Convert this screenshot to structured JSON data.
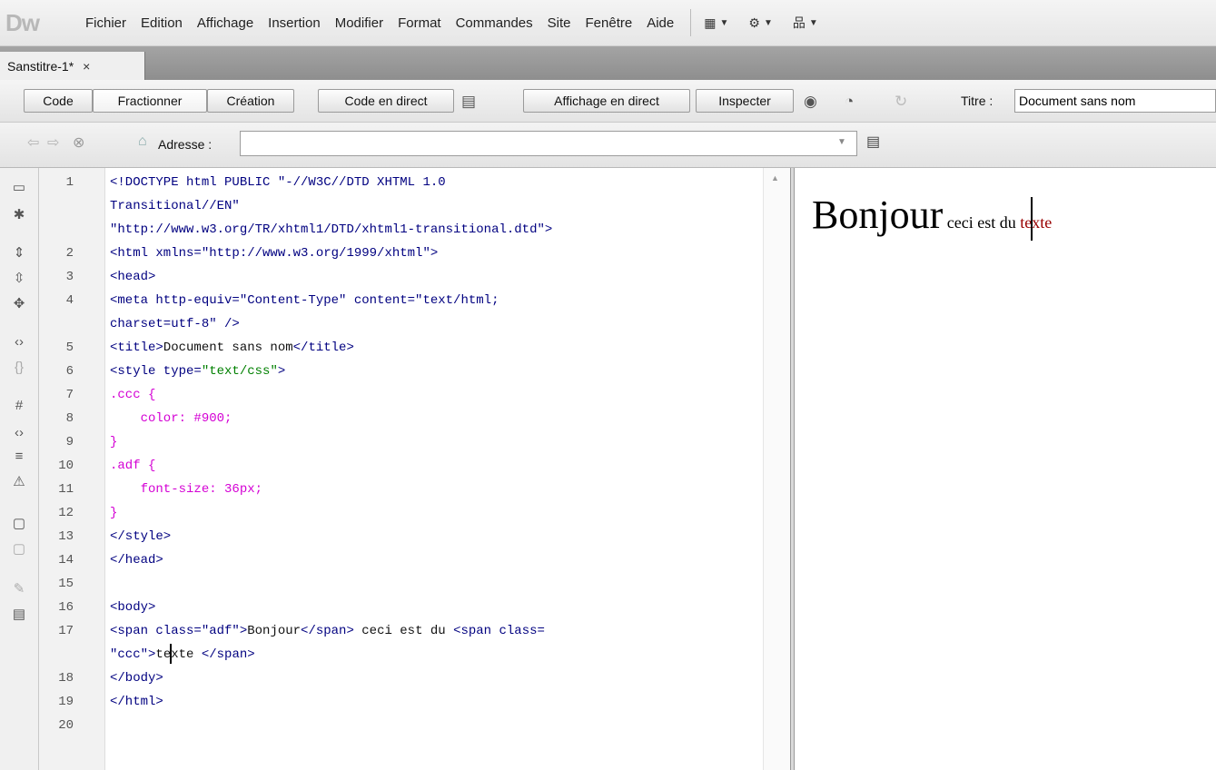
{
  "app": {
    "logo": "Dw"
  },
  "menu": [
    "Fichier",
    "Edition",
    "Affichage",
    "Insertion",
    "Modifier",
    "Format",
    "Commandes",
    "Site",
    "Fenêtre",
    "Aide"
  ],
  "menu_icons": [
    {
      "name": "layout-icon",
      "glyph": "▦"
    },
    {
      "name": "gear-icon",
      "glyph": "⚙"
    },
    {
      "name": "site-icon",
      "glyph": "品"
    }
  ],
  "document_tab": {
    "label": "Sanstitre-1*",
    "close": "×"
  },
  "view_buttons": {
    "code": "Code",
    "split": "Fractionner",
    "design": "Création",
    "live_code": "Code en direct",
    "live_view": "Affichage en direct",
    "inspect": "Inspecter"
  },
  "title_field": {
    "label": "Titre :",
    "value": "Document sans nom"
  },
  "address_bar": {
    "label": "Adresse :",
    "value": ""
  },
  "code_lines": [
    {
      "n": "1",
      "parts": [
        [
          "tag",
          "<!DOCTYPE html PUBLIC \"-//W3C//DTD XHTML 1.0"
        ]
      ]
    },
    {
      "n": "",
      "parts": [
        [
          "tag",
          "Transitional//EN\""
        ]
      ]
    },
    {
      "n": "",
      "parts": [
        [
          "tag",
          "\"http://www.w3.org/TR/xhtml1/DTD/xhtml1-transitional.dtd\">"
        ]
      ]
    },
    {
      "n": "2",
      "parts": [
        [
          "tag",
          "<html xmlns=\"http://www.w3.org/1999/xhtml\">"
        ]
      ]
    },
    {
      "n": "3",
      "parts": [
        [
          "tag",
          "<head>"
        ]
      ]
    },
    {
      "n": "4",
      "parts": [
        [
          "tag",
          "<meta http-equiv=\"Content-Type\" content=\"text/html;"
        ]
      ]
    },
    {
      "n": "",
      "parts": [
        [
          "tag",
          "charset=utf-8\" />"
        ]
      ]
    },
    {
      "n": "5",
      "parts": [
        [
          "tag",
          "<title>"
        ],
        [
          "black",
          "Document sans nom"
        ],
        [
          "tag",
          "</title>"
        ]
      ]
    },
    {
      "n": "6",
      "parts": [
        [
          "tag",
          "<style type="
        ],
        [
          "green",
          "\"text/css\""
        ],
        [
          "tag",
          ">"
        ]
      ]
    },
    {
      "n": "7",
      "parts": [
        [
          "magenta",
          ".ccc {"
        ]
      ]
    },
    {
      "n": "8",
      "parts": [
        [
          "magenta",
          "    color: #900;"
        ]
      ]
    },
    {
      "n": "9",
      "parts": [
        [
          "magenta",
          "}"
        ]
      ]
    },
    {
      "n": "10",
      "parts": [
        [
          "magenta",
          ".adf {"
        ]
      ]
    },
    {
      "n": "11",
      "parts": [
        [
          "magenta",
          "    font-size: 36px;"
        ]
      ]
    },
    {
      "n": "12",
      "parts": [
        [
          "magenta",
          "}"
        ]
      ]
    },
    {
      "n": "13",
      "parts": [
        [
          "tag",
          "</style>"
        ]
      ]
    },
    {
      "n": "14",
      "parts": [
        [
          "tag",
          "</head>"
        ]
      ]
    },
    {
      "n": "15",
      "parts": []
    },
    {
      "n": "16",
      "parts": [
        [
          "tag",
          "<body>"
        ]
      ]
    },
    {
      "n": "17",
      "parts": [
        [
          "tag",
          "<span class=\"adf\">"
        ],
        [
          "black",
          "Bonjour"
        ],
        [
          "tag",
          "</span>"
        ],
        [
          "black",
          " ceci est du "
        ],
        [
          "tag",
          "<span class="
        ]
      ]
    },
    {
      "n": "",
      "parts": [
        [
          "tag",
          "\"ccc\">"
        ],
        [
          "black",
          "te"
        ],
        [
          "cursor",
          ""
        ],
        [
          "black",
          "xte "
        ],
        [
          "tag",
          "</span>"
        ]
      ]
    },
    {
      "n": "18",
      "parts": [
        [
          "tag",
          "</body>"
        ]
      ]
    },
    {
      "n": "19",
      "parts": [
        [
          "tag",
          "</html>"
        ]
      ]
    },
    {
      "n": "20",
      "parts": []
    }
  ],
  "preview": {
    "big": "Bonjour",
    "normal": " ceci est du ",
    "red_before_caret": "te",
    "red_after_caret": "xte"
  },
  "colors": {
    "code_tag": "#000080",
    "css": "#d400d4",
    "red_text": "#990000"
  }
}
